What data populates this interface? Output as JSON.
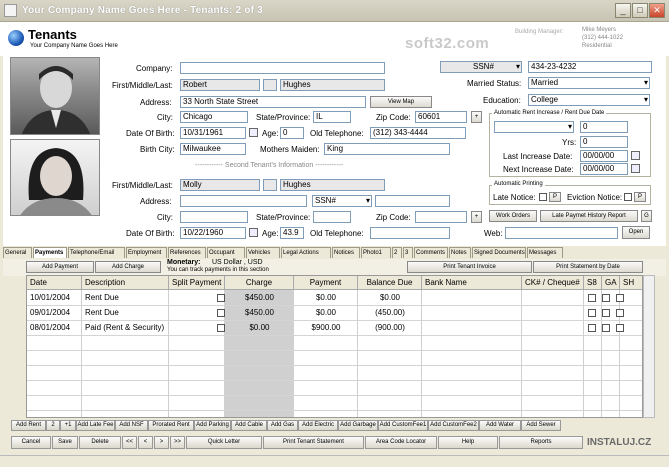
{
  "window": {
    "title": "Your Company Name Goes Here  -  Tenants: 2 of 3"
  },
  "header": {
    "title": "Tenants",
    "subtitle": "Your Company Name Goes Here",
    "building_manager_label": "Building Manager:",
    "manager_name": "Mike Meyers",
    "manager_phone": "(312) 444-1022",
    "manager_type": "Residential",
    "watermark": "soft32.com"
  },
  "tenant1": {
    "company_label": "Company:",
    "company": "",
    "name_label": "First/Middle/Last:",
    "first": "Robert",
    "middle": "",
    "last": "Hughes",
    "address_label": "Address:",
    "address": "33 North State Street",
    "view_map": "View Map",
    "city_label": "City:",
    "city": "Chicago",
    "state_label": "State/Province:",
    "state": "IL",
    "zip_label": "Zip Code:",
    "zip": "60601",
    "dob_label": "Date Of Birth:",
    "dob": "10/31/1961",
    "age_label": "Age:",
    "age": "0",
    "old_tel_label": "Old Telephone:",
    "old_tel": "(312) 343-4444",
    "birth_city_label": "Birth City:",
    "birth_city": "Milwaukee",
    "maiden_label": "Mothers Maiden:",
    "maiden": "King"
  },
  "right": {
    "ssn_select": "SSN#",
    "ssn": "434-23-4232",
    "married_label": "Married Status:",
    "married": "Married",
    "education_label": "Education:",
    "education": "College",
    "rent_increase_title": "Automatic Rent Increase / Rent Due Date",
    "rent_amount": "0",
    "yrs_label": "Yrs:",
    "yrs": "0",
    "last_inc_label": "Last Increase Date:",
    "last_inc": "00/00/00",
    "next_inc_label": "Next Increase Date:",
    "next_inc": "00/00/00",
    "printing_title": "Automatic Printing",
    "late_notice_label": "Late Notice:",
    "eviction_label": "Eviction Notice:",
    "p1": "P",
    "p2": "P",
    "work_orders": "Work Orders",
    "late_history": "Late Paymet History Report",
    "g": "G",
    "web_label": "Web:",
    "web": "",
    "open": "Open"
  },
  "tenant2": {
    "separator": "------------  Second Tenant's Information  ------------",
    "name_label": "First/Middle/Last:",
    "first": "Molly",
    "middle": "",
    "last": "Hughes",
    "address_label": "Address:",
    "address": "",
    "ssn_select": "SSN#",
    "city_label": "City:",
    "city": "",
    "state_label": "State/Province:",
    "state": "",
    "zip_label": "Zip Code:",
    "zip": "",
    "dob_label": "Date Of Birth:",
    "dob": "10/22/1960",
    "age_label": "Age:",
    "age": "43.9",
    "old_tel_label": "Old Telephone:",
    "old_tel": ""
  },
  "tabs": [
    "General",
    "Payments",
    "Telephone/Email",
    "Employment",
    "References",
    "Occupant",
    "Vehicles",
    "Legal Actions",
    "Notices",
    "Photo1",
    "2",
    "3",
    "Comments",
    "Notes",
    "Signed Documents",
    "Messages"
  ],
  "active_tab": "Payments",
  "payments_bar": {
    "add_payment": "Add Payment",
    "add_charge": "Add Charge",
    "monetary_label": "Monetary:",
    "monetary_value": "US Dollar , USD",
    "monetary_note": "You can track payments in this section",
    "print_invoice": "Print Tenant Invoice",
    "print_statement": "Print Statement by Date"
  },
  "grid": {
    "headers": [
      "Date",
      "Description",
      "Split Payment",
      "Charge",
      "Payment",
      "Balance Due",
      "Bank Name",
      "CK# / Cheque#",
      "S8",
      "GA",
      "SH"
    ],
    "rows": [
      {
        "date": "10/01/2004",
        "desc": "Rent Due",
        "charge": "$450.00",
        "payment": "$0.00",
        "balance": "$0.00"
      },
      {
        "date": "09/01/2004",
        "desc": "Rent Due",
        "charge": "$450.00",
        "payment": "$0.00",
        "balance": "(450.00)"
      },
      {
        "date": "08/01/2004",
        "desc": "Paid (Rent & Security)",
        "charge": "$0.00",
        "payment": "$900.00",
        "balance": "(900.00)"
      }
    ]
  },
  "bottom_buttons": [
    "Add Rent",
    "2",
    "+1",
    "Add Late Fee",
    "Add NSF",
    "Prorated Rent",
    "Add Parking",
    "Add Cable",
    "Add Gas",
    "Add Electric",
    "Add Garbage",
    "Add CustomFee1",
    "Add CustomFee2",
    "Add Water",
    "Add Sewer"
  ],
  "footer_buttons": [
    "Cancel",
    "Save",
    "Delete",
    "<<",
    "<",
    ">",
    ">>",
    "Quick Letter",
    "Print Tenant Statement",
    "Area Code Locator",
    "Help",
    "Reports"
  ],
  "installer_mark": "INSTALUJ.CZ"
}
